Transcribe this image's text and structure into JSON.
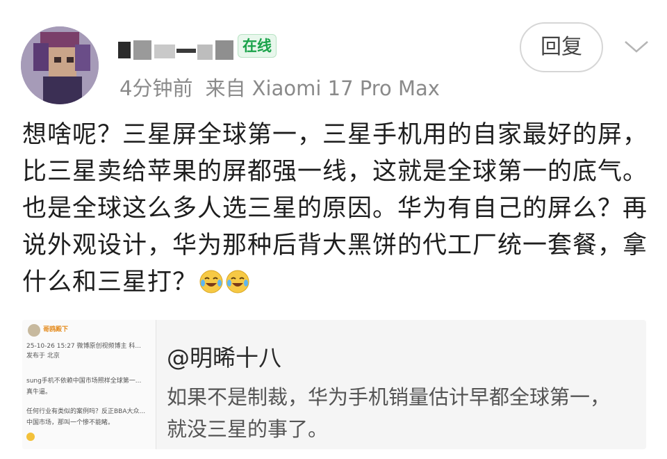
{
  "header": {
    "online_badge": "在线",
    "time_ago": "4分钟前",
    "source": "来自 Xiaomi 17 Pro Max",
    "reply_label": "回复",
    "expand_icon": "chevron-down-icon"
  },
  "post": {
    "body": "想啥呢？三星屏全球第一，三星手机用的自家最好的屏，比三星卖给苹果的屏都强一线，这就是全球第一的底气。也是全球这么多人选三星的原因。华为有自己的屏么？再说外观设计，华为那种后背大黑饼的代工厂统一套餐，拿什么和三星打？",
    "emoji_icon": "laugh-cry-emoji-icon"
  },
  "quote": {
    "username": "@明晞十八",
    "text": "如果不是制裁，华为手机销量估计早都全球第一，就没三星的事了。",
    "thumbnail": {
      "user": "哥鸥殿下",
      "lines": [
        "25-10-26 15:27  微博原创视频博主 科...",
        "发布于 北京",
        "sung手机不依赖中国市场照样全球第一...",
        "真牛逼。",
        "任何行业有类似的案例吗？反正BBA大众...",
        "中国市场，那叫一个惨不能睹。"
      ]
    }
  },
  "colors": {
    "online_green": "#1aa34a",
    "meta_gray": "#8a8a8a",
    "quote_bg": "#f5f5f5"
  }
}
